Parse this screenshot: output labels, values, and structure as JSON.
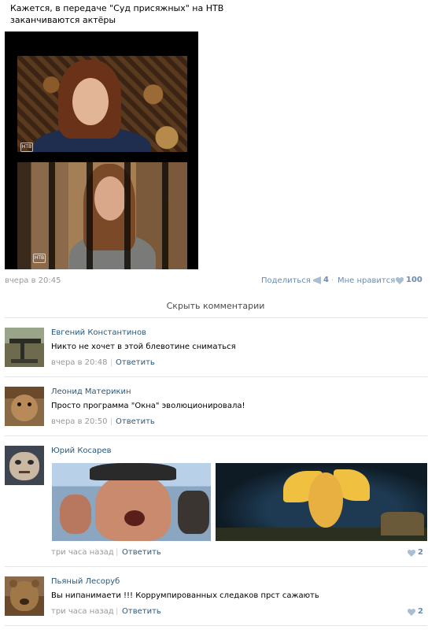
{
  "post": {
    "text": "Кажется, в передаче \"Суд присяжных\" на НТВ заканчиваются актёры",
    "watermark": "НТВ",
    "time": "вчера в 20:45",
    "share_label": "Поделиться",
    "share_count": "4",
    "like_label": "Мне нравится",
    "like_count": "100"
  },
  "comments_toggle": "Скрыть комментарии",
  "comments": [
    {
      "author": "Евгений Константинов",
      "text": "Никто не хочет в этой блевотине сниматься",
      "time": "вчера в 20:48",
      "reply": "Ответить"
    },
    {
      "author": "Леонид Материкин",
      "text": "Просто программа \"Окна\" эволюционировала!",
      "time": "вчера в 20:50",
      "reply": "Ответить"
    },
    {
      "author": "Юрий Косарев",
      "text": "",
      "time": "три часа назад",
      "reply": "Ответить",
      "likes": "2"
    },
    {
      "author": "Пьяный Лесоруб",
      "text": "Вы нипанимаети !!! Коррумпированных следаков прст сажають",
      "time": "три часа назад",
      "reply": "Ответить",
      "likes": "2"
    }
  ],
  "colors": {
    "link": "#2b587a",
    "meta": "#999999",
    "action": "#6b8ab0",
    "divider": "#e2e6ea"
  },
  "icons": {
    "share": "megaphone-icon",
    "like": "heart-icon"
  }
}
